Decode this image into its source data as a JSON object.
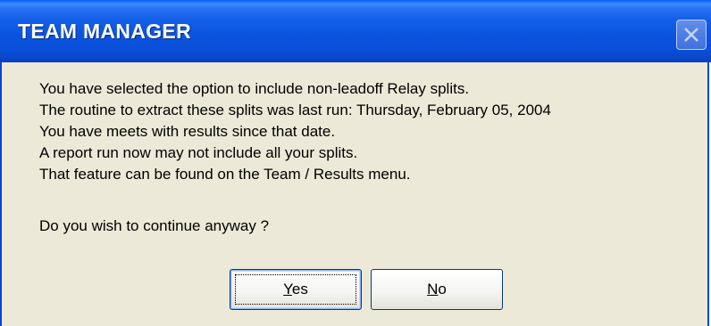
{
  "window": {
    "title": "TEAM MANAGER",
    "close_icon": "close-icon"
  },
  "message": {
    "lines": [
      "You have selected the option to include non-leadoff Relay splits.",
      "The routine to extract these splits was last run: Thursday, February 05, 2004",
      "You have meets with results since that date.",
      "A report run now may not include all your splits.",
      "That feature can be found on the Team / Results menu."
    ],
    "prompt": "Do you wish to continue anyway ?"
  },
  "buttons": {
    "yes": {
      "mnemonic": "Y",
      "rest": "es"
    },
    "no": {
      "mnemonic": "N",
      "rest": "o"
    }
  },
  "colors": {
    "titlebar": "#0a54e0",
    "dialog_background": "#ece9d8",
    "button_border": "#003c74"
  }
}
